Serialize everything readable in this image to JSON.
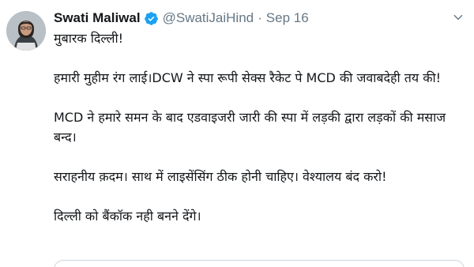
{
  "author": {
    "display_name": "Swati Maliwal",
    "handle": "@SwatiJaiHind",
    "separator": "·",
    "date": "Sep 16",
    "verified": true
  },
  "tweet": {
    "paragraphs": [
      "मुबारक दिल्ली!",
      "हमारी मुहीम रंग लाई।DCW ने स्पा रूपी सेक्स रैकेट पे MCD की जवाबदेही तय की!",
      "MCD ने हमारे समन के बाद एडवाइजरी जारी की स्पा में लड़की द्वारा लड़कों की मसाज बन्द।",
      "सराहनीय क़दम। साथ में लाइसेंसिंग ठीक होनी चाहिए। वेश्यालय बंद करो!",
      "दिल्ली को बैंकॉक नही बनने देंगे।"
    ]
  },
  "icons": {
    "verified": "verified-badge-icon",
    "more": "chevron-down-icon"
  },
  "colors": {
    "verified_blue": "#1da1f2",
    "secondary_text": "#657786",
    "primary_text": "#14171a",
    "border": "#ccd6dd"
  }
}
